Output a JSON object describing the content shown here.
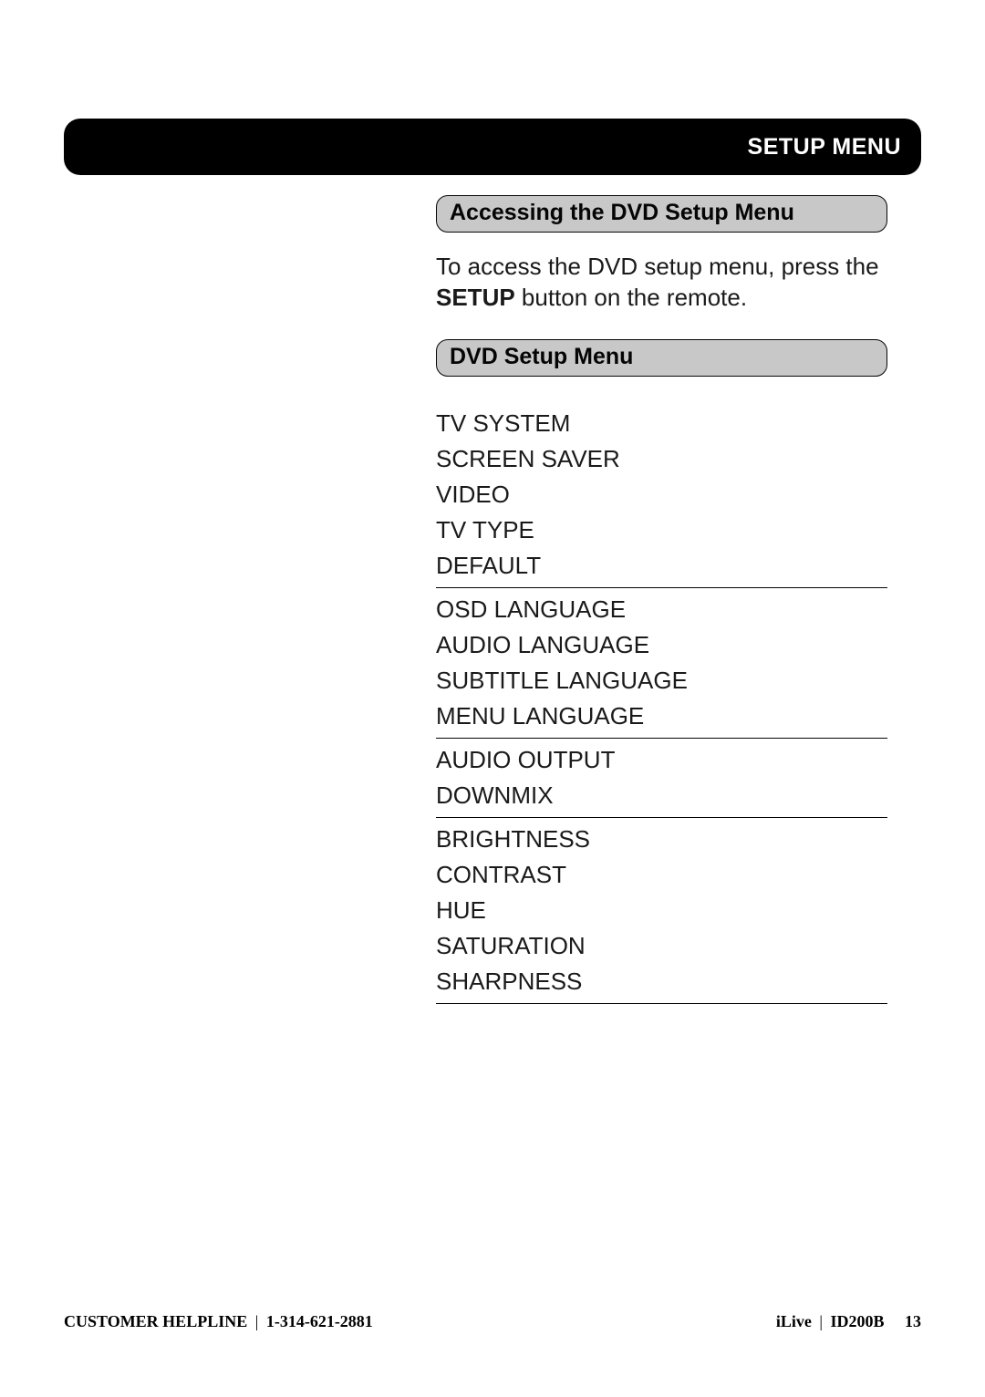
{
  "header": {
    "title": "Setup Menu"
  },
  "section1": {
    "heading": "Accessing the DVD Setup Menu",
    "para_pre": "To access the DVD setup menu, press the ",
    "para_bold": "SETUP",
    "para_post": " button on the remote."
  },
  "section2": {
    "heading": "DVD Setup Menu",
    "groups": [
      {
        "items": [
          "TV SYSTEM",
          "SCREEN SAVER",
          "VIDEO",
          "TV TYPE",
          "DEFAULT"
        ]
      },
      {
        "items": [
          "OSD LANGUAGE",
          "AUDIO LANGUAGE",
          "SUBTITLE LANGUAGE",
          "MENU LANGUAGE"
        ]
      },
      {
        "items": [
          "AUDIO OUTPUT",
          "DOWNMIX"
        ]
      },
      {
        "items": [
          "BRIGHTNESS",
          "CONTRAST",
          "HUE",
          "SATURATION",
          "SHARPNESS"
        ]
      }
    ]
  },
  "footer": {
    "helpline_label": "CUSTOMER HELPLINE",
    "helpline_number": "1-314-621-2881",
    "brand": "iLive",
    "model": "ID200B",
    "page": "13"
  }
}
